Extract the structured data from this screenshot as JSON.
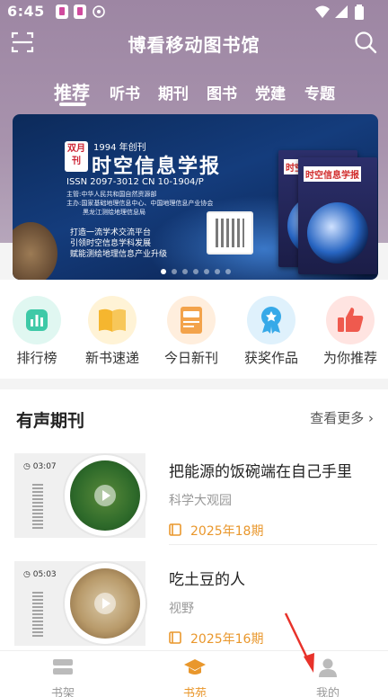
{
  "status_bar": {
    "time": "6:45"
  },
  "header": {
    "title": "博看移动图书馆"
  },
  "tabs": [
    {
      "label": "推荐",
      "active": true
    },
    {
      "label": "听书"
    },
    {
      "label": "期刊"
    },
    {
      "label": "图书"
    },
    {
      "label": "党建"
    },
    {
      "label": "专题"
    }
  ],
  "banner": {
    "badge": "双月刊",
    "since": "1994 年创刊",
    "title": "时空信息学报",
    "issn": "ISSN 2097-3012   CN 10-1904/P",
    "sponsor_lines": [
      "主管:中华人民共和国自然资源部",
      "主办:国家基础地理信息中心、中国地理信息产业协会",
      "黑龙江测绘地理信息局"
    ],
    "slogans": [
      "打造一流学术交流平台",
      "引领时空信息学科发展",
      "赋能测绘地理信息产业升级"
    ],
    "cover_title": "时空信息学报",
    "pages": 7,
    "current_page": 1
  },
  "quick_links": [
    {
      "label": "排行榜",
      "icon": "ranking-icon",
      "color": "#3ec9a7"
    },
    {
      "label": "新书速递",
      "icon": "new-book-icon",
      "color": "#f5b62f"
    },
    {
      "label": "今日新刊",
      "icon": "new-magazine-icon",
      "color": "#f3a34b"
    },
    {
      "label": "获奖作品",
      "icon": "award-icon",
      "color": "#37a9e8"
    },
    {
      "label": "为你推荐",
      "icon": "thumbs-up-icon",
      "color": "#ef5a4e"
    }
  ],
  "audio_section": {
    "title": "有声期刊",
    "more": "查看更多",
    "items": [
      {
        "title": "把能源的饭碗端在自己手里",
        "source": "科学大观园",
        "issue": "2025年18期",
        "duration": "03:07"
      },
      {
        "title": "吃土豆的人",
        "source": "视野",
        "issue": "2025年16期",
        "duration": "05:03"
      }
    ]
  },
  "bottom_nav": [
    {
      "label": "书架",
      "icon": "bookshelf-icon"
    },
    {
      "label": "书苑",
      "icon": "graduation-cap-icon",
      "active": true
    },
    {
      "label": "我的",
      "icon": "user-icon"
    }
  ],
  "colors": {
    "accent": "#e9972c",
    "header_bg": "#a893ad"
  }
}
